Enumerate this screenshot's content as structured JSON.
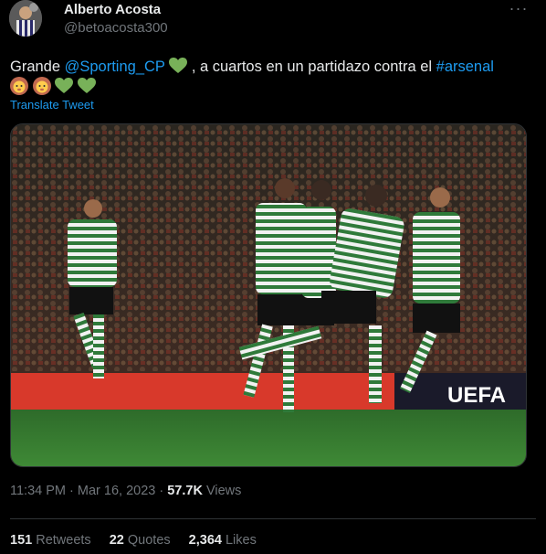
{
  "author": {
    "display_name": "Alberto Acosta",
    "handle": "@betoacosta300",
    "avatar_icon": "profile-photo"
  },
  "menu": {
    "more_icon": "ellipsis-icon",
    "more_label": "···"
  },
  "tweet": {
    "text_parts": {
      "p1": "Grande ",
      "mention": "@Sporting_CP",
      "p2": " , a cuartos en un partidazo contra el ",
      "hashtag": "#arsenal"
    },
    "emojis": [
      "green-heart",
      "lion",
      "lion",
      "green-heart",
      "green-heart"
    ],
    "translate_label": "Translate Tweet"
  },
  "media": {
    "description_icon": "photo-sporting-players-celebrating",
    "board_text": "UEFA"
  },
  "meta": {
    "time": "11:34 PM",
    "sep1": " · ",
    "date": "Mar 16, 2023",
    "sep2": " · ",
    "views_count": "57.7K",
    "views_label": " Views"
  },
  "stats": {
    "retweets_count": "151",
    "retweets_label": " Retweets",
    "quotes_count": "22",
    "quotes_label": " Quotes",
    "likes_count": "2,364",
    "likes_label": " Likes"
  },
  "colors": {
    "background": "#000000",
    "text": "#e7e9ea",
    "secondary": "#71767b",
    "link": "#1d9bf0",
    "divider": "#2f3336",
    "heart_green": "#78b159"
  }
}
